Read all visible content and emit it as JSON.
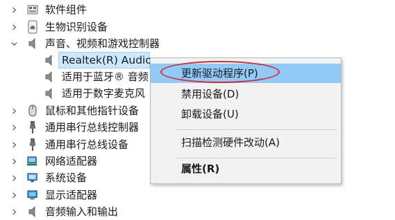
{
  "tree": {
    "items": [
      {
        "label": "软件组件",
        "expanded": false,
        "icon": "software-component-icon"
      },
      {
        "label": "生物识别设备",
        "expanded": false,
        "icon": "fingerprint-icon"
      },
      {
        "label": "声音、视频和游戏控制器",
        "expanded": true,
        "icon": "speaker-icon"
      },
      {
        "label": "鼠标和其他指针设备",
        "expanded": false,
        "icon": "mouse-icon"
      },
      {
        "label": "通用串行总线控制器",
        "expanded": false,
        "icon": "usb-icon"
      },
      {
        "label": "通用串行总线设备",
        "expanded": false,
        "icon": "usb-icon"
      },
      {
        "label": "网络适配器",
        "expanded": false,
        "icon": "network-adapter-icon"
      },
      {
        "label": "系统设备",
        "expanded": false,
        "icon": "system-device-icon"
      },
      {
        "label": "显示适配器",
        "expanded": false,
        "icon": "display-adapter-icon"
      },
      {
        "label": "音频输入和输出",
        "expanded": false,
        "icon": "audio-io-icon"
      }
    ],
    "children": [
      {
        "label": "Realtek(R) Audio",
        "selected": true,
        "icon": "speaker-icon"
      },
      {
        "label": "适用于蓝牙® 音频",
        "selected": false,
        "icon": "speaker-icon"
      },
      {
        "label": "适用于数字麦克风",
        "selected": false,
        "icon": "speaker-icon"
      }
    ]
  },
  "context_menu": {
    "items": [
      {
        "label": "更新驱动程序(P)",
        "highlighted": true
      },
      {
        "label": "禁用设备(D)"
      },
      {
        "label": "卸载设备(U)"
      },
      {
        "label": "扫描检测硬件改动(A)"
      },
      {
        "label": "属性(R)",
        "bold": true
      }
    ]
  },
  "colors": {
    "menu_highlight": "#91c9f7",
    "annotation_red": "#d92a2a",
    "selection": "#cce8ff"
  }
}
